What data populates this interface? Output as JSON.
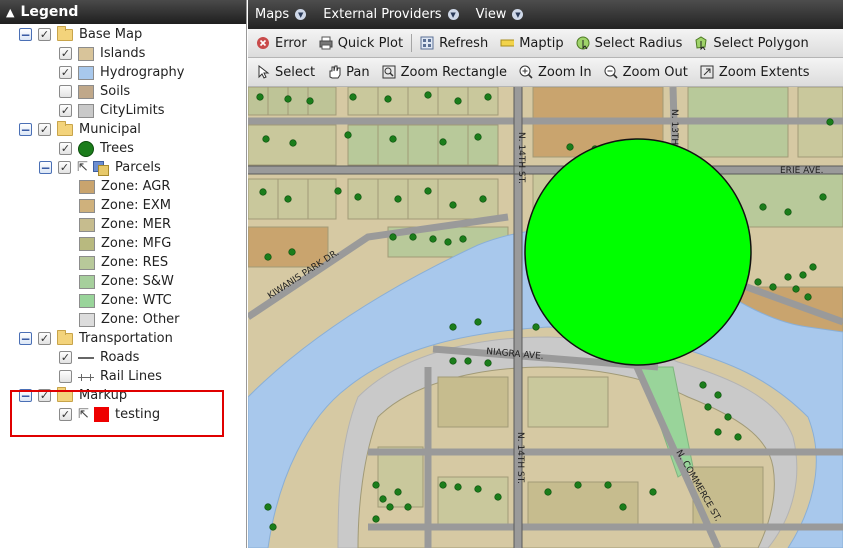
{
  "legend": {
    "title": "Legend",
    "items": [
      {
        "label": "Base Map"
      },
      {
        "label": "Islands",
        "color": "#d8c49a"
      },
      {
        "label": "Hydrography",
        "color": "#a8c8ec"
      },
      {
        "label": "Soils",
        "color": "#c0a88a"
      },
      {
        "label": "CityLimits",
        "color": "#c9c9c9"
      },
      {
        "label": "Municipal"
      },
      {
        "label": "Trees",
        "color": "#1b7d1b"
      },
      {
        "label": "Parcels"
      },
      {
        "label": "Zone: AGR",
        "color": "#c9a46e"
      },
      {
        "label": "Zone: EXM",
        "color": "#cfb17c"
      },
      {
        "label": "Zone: MER",
        "color": "#c6bc8e"
      },
      {
        "label": "Zone: MFG",
        "color": "#b8b97f"
      },
      {
        "label": "Zone: RES",
        "color": "#b8c99a"
      },
      {
        "label": "Zone: S&W",
        "color": "#a6cf9c"
      },
      {
        "label": "Zone: WTC",
        "color": "#99d49a"
      },
      {
        "label": "Zone: Other",
        "color": "#dcdcdc"
      },
      {
        "label": "Transportation"
      },
      {
        "label": "Roads"
      },
      {
        "label": "Rail Lines"
      },
      {
        "label": "Markup"
      },
      {
        "label": "testing",
        "color": "#ee0000"
      }
    ]
  },
  "menu": {
    "items": [
      "Maps",
      "External Providers",
      "View"
    ]
  },
  "toolbar1": {
    "items": [
      "Error",
      "Quick Plot",
      "Refresh",
      "Maptip",
      "Select Radius",
      "Select Polygon"
    ]
  },
  "toolbar2": {
    "items": [
      "Select",
      "Pan",
      "Zoom Rectangle",
      "Zoom In",
      "Zoom Out",
      "Zoom Extents"
    ]
  },
  "map": {
    "streets": [
      "N. 14TH ST.",
      "N. 13TH ST.",
      "ERIE AVE.",
      "KIWANIS PARK DR.",
      "NIAGRA AVE.",
      "N. 14TH ST.",
      "N. COMMERCE ST."
    ],
    "selection_color": "#00ff00",
    "water_color": "#a8c8ec",
    "land_color": "#d6c9a3",
    "tree_color": "#1b7d1b"
  }
}
